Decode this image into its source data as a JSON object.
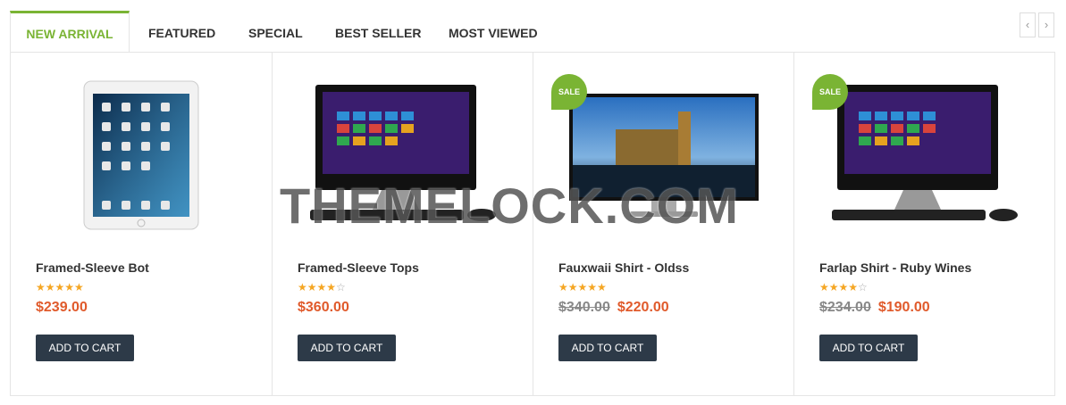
{
  "tabs": [
    {
      "label": "NEW ARRIVAL",
      "active": true
    },
    {
      "label": "FEATURED",
      "active": false
    },
    {
      "label": "SPECIAL",
      "active": false
    },
    {
      "label": "BEST SELLER",
      "active": false
    },
    {
      "label": "MOST VIEWED",
      "active": false
    }
  ],
  "nav": {
    "prev_icon": "‹",
    "next_icon": "›"
  },
  "products": [
    {
      "title": "Framed-Sleeve Bot",
      "rating": 5,
      "old_price": "",
      "price": "$239.00",
      "cart_label": "ADD TO CART",
      "sale": "",
      "image": "tablet"
    },
    {
      "title": "Framed-Sleeve Tops",
      "rating": 4,
      "old_price": "",
      "price": "$360.00",
      "cart_label": "ADD TO CART",
      "sale": "",
      "image": "all-in-one-pc"
    },
    {
      "title": "Fauxwaii Shirt - Oldss",
      "rating": 5,
      "old_price": "$340.00",
      "price": "$220.00",
      "cart_label": "ADD TO CART",
      "sale": "SALE",
      "image": "monitor-london"
    },
    {
      "title": "Farlap Shirt - Ruby Wines",
      "rating": 4,
      "old_price": "$234.00",
      "price": "$190.00",
      "cart_label": "ADD TO CART",
      "sale": "SALE",
      "image": "all-in-one-pc"
    }
  ],
  "watermark": "THEMELOCK.COM",
  "colors": {
    "accent": "#7ab434",
    "price": "#e05a2b",
    "button": "#2d3a48",
    "star": "#f5a623"
  }
}
